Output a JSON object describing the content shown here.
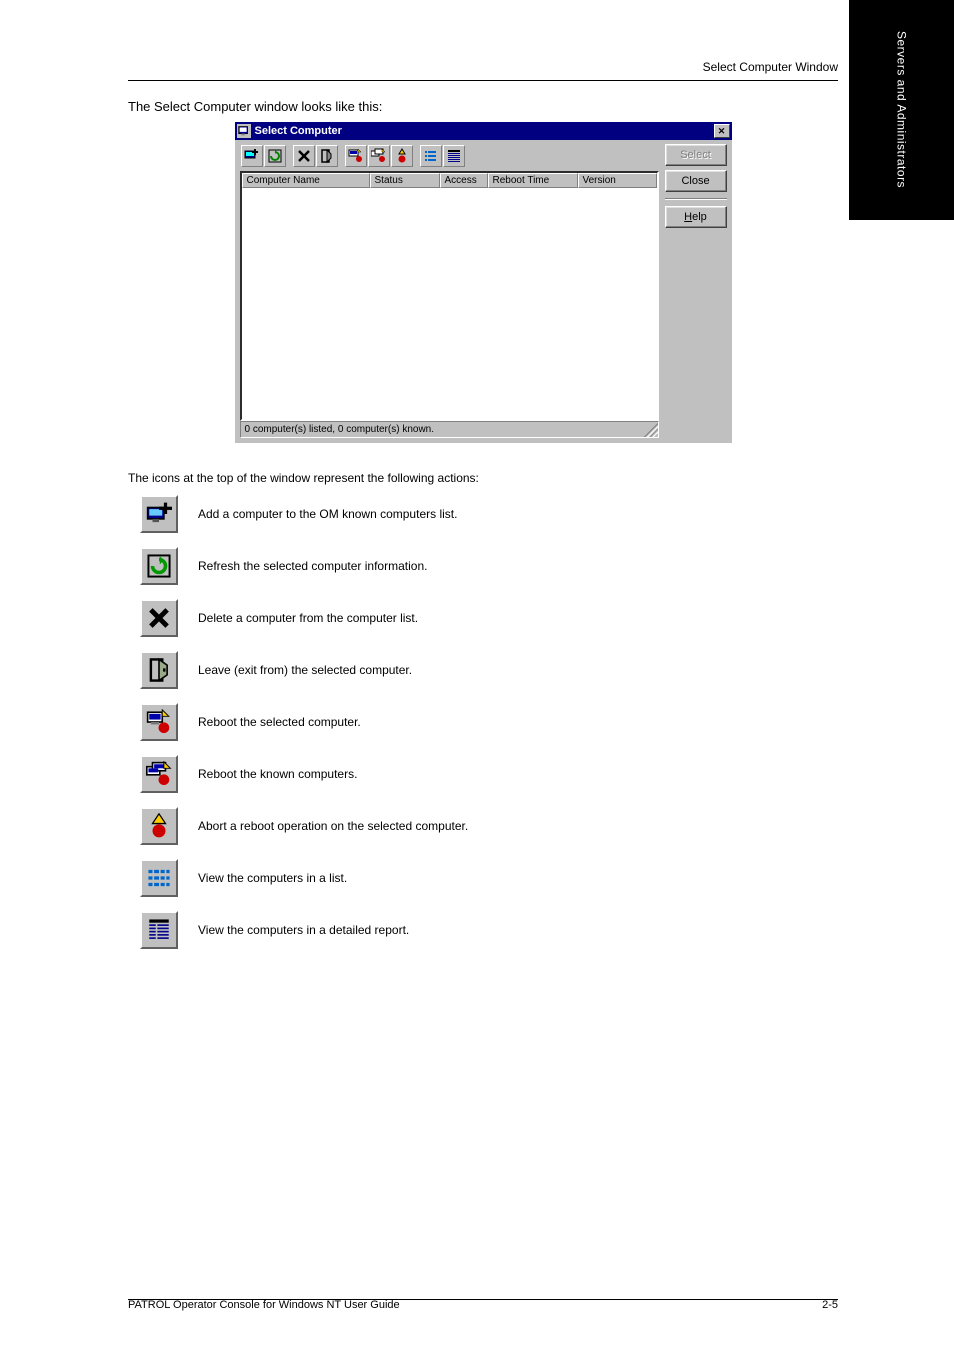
{
  "page": {
    "tab_label": "Servers and Administrators",
    "running_head": "Select Computer Window",
    "intro": "The Select Computer window looks like this:",
    "icon_list_intro": "The icons at the top of the window represent the following actions:"
  },
  "dialog": {
    "title": "Select Computer",
    "columns": {
      "name": "Computer Name",
      "status": "Status",
      "access": "Access",
      "reboot": "Reboot Time",
      "version": "Version"
    },
    "buttons": {
      "select": "Select",
      "close": "Close",
      "help": "Help"
    },
    "statusbar": "0 computer(s) listed, 0 computer(s) known."
  },
  "icons": [
    {
      "key": "add",
      "label": "Add a computer to the OM known computers list."
    },
    {
      "key": "refresh",
      "label": "Refresh the selected computer information."
    },
    {
      "key": "delete",
      "label": "Delete a computer from the computer list."
    },
    {
      "key": "exit",
      "label": "Leave (exit from) the selected computer."
    },
    {
      "key": "reboot-selected",
      "label": "Reboot the selected computer."
    },
    {
      "key": "reboot-known",
      "label": "Reboot the known computers."
    },
    {
      "key": "abort-reboot",
      "label": "Abort a reboot operation on the selected computer."
    },
    {
      "key": "view-list",
      "label": "View the computers in a list."
    },
    {
      "key": "view-detail",
      "label": "View the computers in a detailed report."
    }
  ],
  "footer": {
    "left": "PATROL Operator Console for Windows NT User Guide",
    "right": "2-5"
  }
}
